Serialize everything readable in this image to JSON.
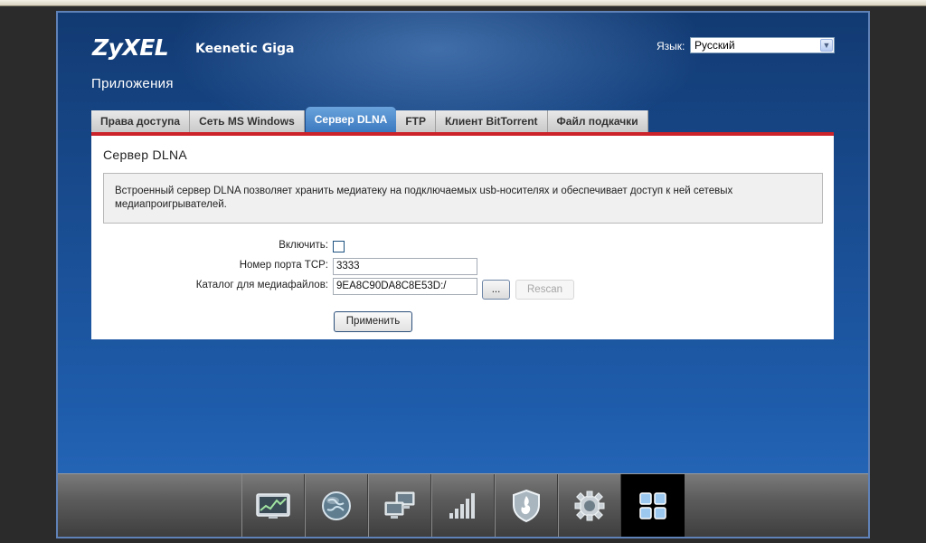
{
  "brand": {
    "logo": "ZyXEL",
    "model": "Keenetic Giga"
  },
  "language": {
    "label": "Язык:",
    "selected": "Русский"
  },
  "page_title": "Приложения",
  "tabs": [
    {
      "label": "Права доступа",
      "active": false
    },
    {
      "label": "Сеть MS Windows",
      "active": false
    },
    {
      "label": "Сервер DLNA",
      "active": true
    },
    {
      "label": "FTP",
      "active": false
    },
    {
      "label": "Клиент BitTorrent",
      "active": false
    },
    {
      "label": "Файл подкачки",
      "active": false
    }
  ],
  "panel": {
    "title": "Сервер DLNA",
    "info_line1": "Встроенный сервер DLNA позволяет хранить медиатеку на подключаемых usb-носителях и обеспечивает доступ к ней сетевых",
    "info_line2": "медиапроигрывателей."
  },
  "form": {
    "enable_label": "Включить:",
    "enable_checked": false,
    "port_label": "Номер порта TCP:",
    "port_value": "3333",
    "dir_label": "Каталог для медиафайлов:",
    "dir_value": "9EA8C90DA8C8E53D:/",
    "browse_label": "...",
    "rescan_label": "Rescan",
    "apply_label": "Применить"
  },
  "dock": [
    {
      "icon": "monitor-chart-icon",
      "active": false
    },
    {
      "icon": "globe-icon",
      "active": false
    },
    {
      "icon": "network-computers-icon",
      "active": false
    },
    {
      "icon": "signal-bars-icon",
      "active": false
    },
    {
      "icon": "shield-icon",
      "active": false
    },
    {
      "icon": "gear-icon",
      "active": false
    },
    {
      "icon": "apps-grid-icon",
      "active": true
    }
  ],
  "colors": {
    "accent_red": "#cc2229",
    "active_tab": "#3b79bf",
    "background_blue": "#1a4f95"
  }
}
